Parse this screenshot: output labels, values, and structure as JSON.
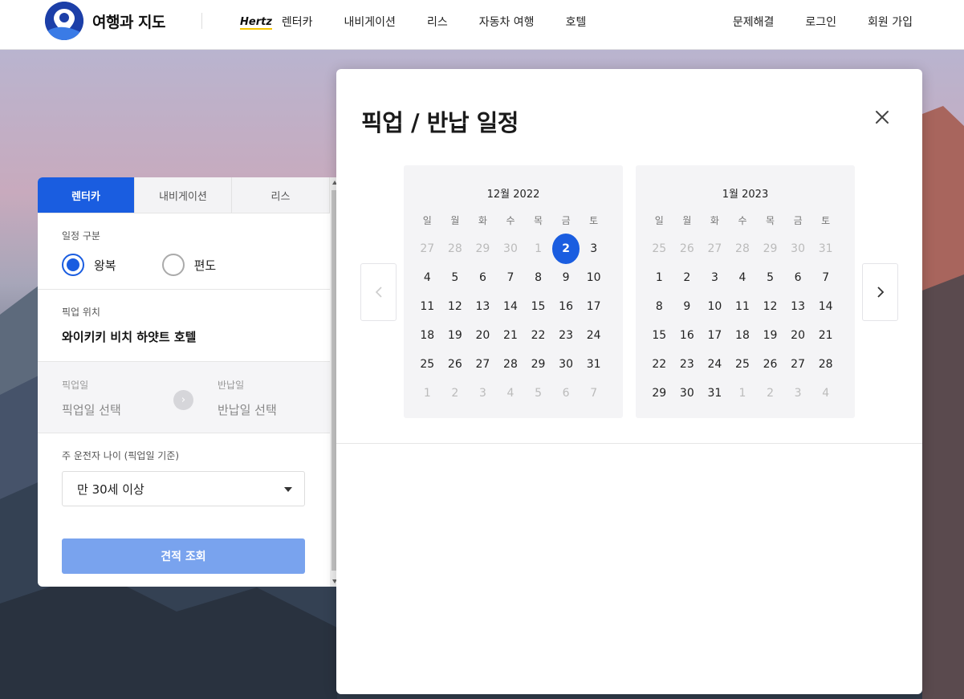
{
  "header": {
    "logo_text": "여행과 지도",
    "brand_badge": "Hertz",
    "nav_items": [
      "렌터카",
      "내비게이션",
      "리스",
      "자동차 여행",
      "호텔"
    ],
    "right_links": [
      "문제해결",
      "로그인",
      "회원 가입"
    ]
  },
  "panel": {
    "tabs": [
      "렌터카",
      "내비게이션",
      "리스"
    ],
    "active_tab": "렌터카",
    "trip_type_label": "일정 구분",
    "trip_options": [
      "왕복",
      "편도"
    ],
    "trip_selected": "왕복",
    "pickup_location_label": "픽업 위치",
    "pickup_location_value": "와이키키 비치 하얏트 호텔",
    "pickup_date_label": "픽업일",
    "pickup_date_placeholder": "픽업일 선택",
    "return_date_label": "반납일",
    "return_date_placeholder": "반납일 선택",
    "driver_age_label": "주 운전자 나이 (픽업일 기준)",
    "driver_age_value": "만 30세 이상",
    "quote_button": "견적 조회"
  },
  "modal": {
    "title": "픽업 / 반납 일정",
    "weekdays": [
      "일",
      "월",
      "화",
      "수",
      "목",
      "금",
      "토"
    ],
    "months": [
      {
        "title": "12월 2022",
        "days": [
          {
            "d": "27",
            "off": true
          },
          {
            "d": "28",
            "off": true
          },
          {
            "d": "29",
            "off": true
          },
          {
            "d": "30",
            "off": true
          },
          {
            "d": "1",
            "off": true
          },
          {
            "d": "2",
            "sel": true
          },
          {
            "d": "3"
          },
          {
            "d": "4"
          },
          {
            "d": "5"
          },
          {
            "d": "6"
          },
          {
            "d": "7"
          },
          {
            "d": "8"
          },
          {
            "d": "9"
          },
          {
            "d": "10"
          },
          {
            "d": "11"
          },
          {
            "d": "12"
          },
          {
            "d": "13"
          },
          {
            "d": "14"
          },
          {
            "d": "15"
          },
          {
            "d": "16"
          },
          {
            "d": "17"
          },
          {
            "d": "18"
          },
          {
            "d": "19"
          },
          {
            "d": "20"
          },
          {
            "d": "21"
          },
          {
            "d": "22"
          },
          {
            "d": "23"
          },
          {
            "d": "24"
          },
          {
            "d": "25"
          },
          {
            "d": "26"
          },
          {
            "d": "27"
          },
          {
            "d": "28"
          },
          {
            "d": "29"
          },
          {
            "d": "30"
          },
          {
            "d": "31"
          },
          {
            "d": "1",
            "off": true
          },
          {
            "d": "2",
            "off": true
          },
          {
            "d": "3",
            "off": true
          },
          {
            "d": "4",
            "off": true
          },
          {
            "d": "5",
            "off": true
          },
          {
            "d": "6",
            "off": true
          },
          {
            "d": "7",
            "off": true
          }
        ]
      },
      {
        "title": "1월 2023",
        "days": [
          {
            "d": "25",
            "off": true
          },
          {
            "d": "26",
            "off": true
          },
          {
            "d": "27",
            "off": true
          },
          {
            "d": "28",
            "off": true
          },
          {
            "d": "29",
            "off": true
          },
          {
            "d": "30",
            "off": true
          },
          {
            "d": "31",
            "off": true
          },
          {
            "d": "1"
          },
          {
            "d": "2"
          },
          {
            "d": "3"
          },
          {
            "d": "4"
          },
          {
            "d": "5"
          },
          {
            "d": "6"
          },
          {
            "d": "7"
          },
          {
            "d": "8"
          },
          {
            "d": "9"
          },
          {
            "d": "10"
          },
          {
            "d": "11"
          },
          {
            "d": "12"
          },
          {
            "d": "13"
          },
          {
            "d": "14"
          },
          {
            "d": "15"
          },
          {
            "d": "16"
          },
          {
            "d": "17"
          },
          {
            "d": "18"
          },
          {
            "d": "19"
          },
          {
            "d": "20"
          },
          {
            "d": "21"
          },
          {
            "d": "22"
          },
          {
            "d": "23"
          },
          {
            "d": "24"
          },
          {
            "d": "25"
          },
          {
            "d": "26"
          },
          {
            "d": "27"
          },
          {
            "d": "28"
          },
          {
            "d": "29"
          },
          {
            "d": "30"
          },
          {
            "d": "31"
          },
          {
            "d": "1",
            "off": true
          },
          {
            "d": "2",
            "off": true
          },
          {
            "d": "3",
            "off": true
          },
          {
            "d": "4",
            "off": true
          }
        ]
      }
    ]
  },
  "colors": {
    "accent": "#1a5de0",
    "button_disabled": "#79a3ee",
    "logo": "#1c3fa8"
  }
}
